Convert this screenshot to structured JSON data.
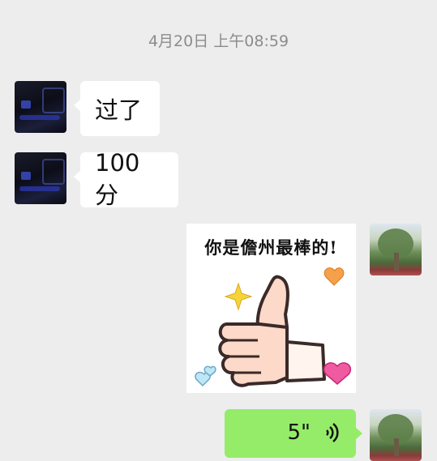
{
  "timestamp": "4月20日 上午08:59",
  "messages": [
    {
      "side": "left",
      "type": "text",
      "text": "过了"
    },
    {
      "side": "left",
      "type": "text",
      "text": "100 分"
    },
    {
      "side": "right",
      "type": "sticker",
      "caption": "你是儋州最棒的!"
    },
    {
      "side": "right",
      "type": "voice",
      "duration": "5\""
    }
  ],
  "icons": {
    "left_avatar": "dark-car-interior-avatar",
    "right_avatar": "tree-photo-avatar",
    "voice": "voice-wave-icon"
  },
  "colors": {
    "background": "#ededed",
    "incoming_bubble": "#ffffff",
    "outgoing_bubble": "#95ec69",
    "timestamp_text": "#8c8c8c"
  }
}
